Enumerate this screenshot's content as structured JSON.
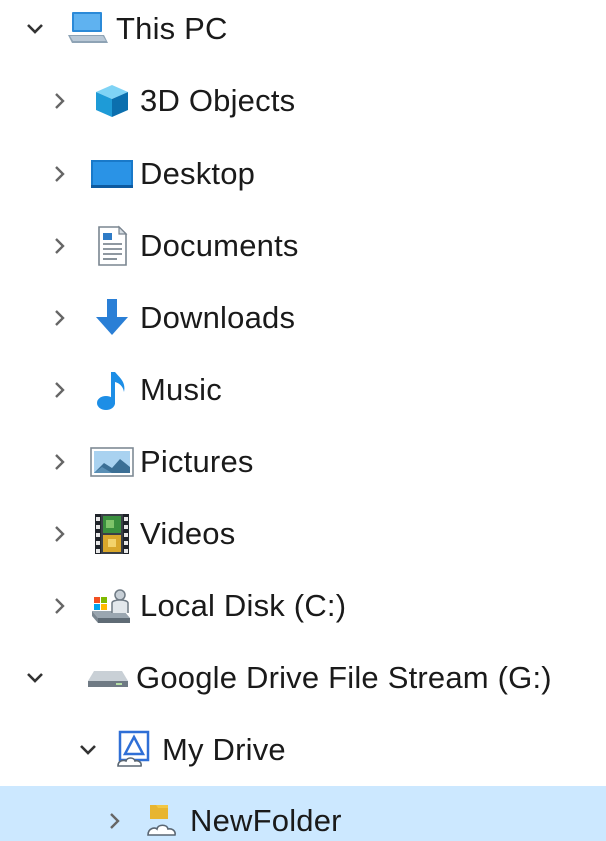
{
  "tree": {
    "this_pc": {
      "label": "This PC",
      "expanded": true,
      "icon": "computer-icon"
    },
    "items": [
      {
        "label": "3D Objects",
        "icon": "3d-objects-icon"
      },
      {
        "label": "Desktop",
        "icon": "desktop-icon"
      },
      {
        "label": "Documents",
        "icon": "documents-icon"
      },
      {
        "label": "Downloads",
        "icon": "downloads-icon"
      },
      {
        "label": "Music",
        "icon": "music-icon"
      },
      {
        "label": "Pictures",
        "icon": "pictures-icon"
      },
      {
        "label": "Videos",
        "icon": "videos-icon"
      },
      {
        "label": "Local Disk (C:)",
        "icon": "local-disk-icon"
      }
    ],
    "google_drive": {
      "label": "Google Drive File Stream (G:)",
      "expanded": true,
      "icon": "drive-icon"
    },
    "my_drive": {
      "label": "My Drive",
      "expanded": true,
      "icon": "my-drive-icon"
    },
    "new_folder": {
      "label": "NewFolder",
      "selected": true,
      "icon": "shared-folder-icon"
    }
  },
  "colors": {
    "selection_bg": "#cce8ff",
    "chevron": "#555555",
    "text": "#1a1a1a"
  }
}
